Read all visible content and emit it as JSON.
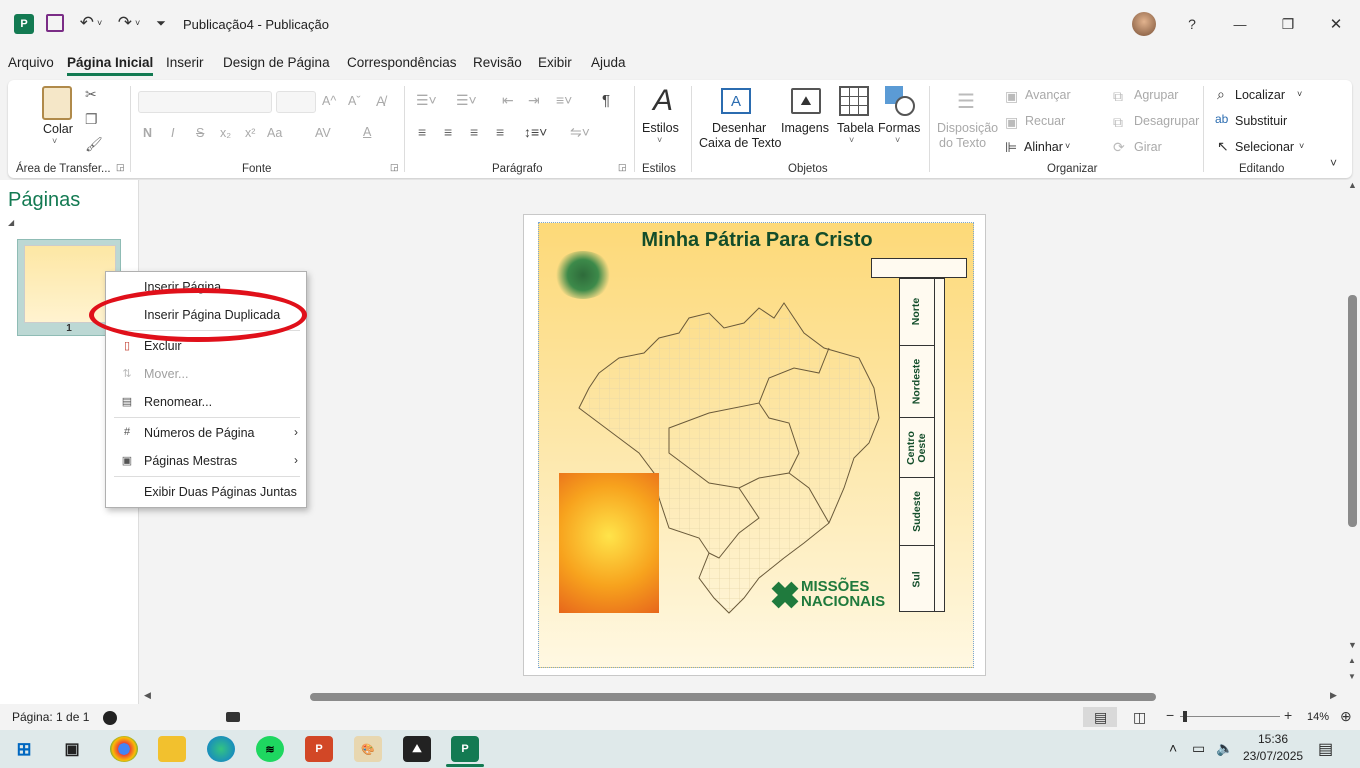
{
  "window": {
    "title": "Publicação4  -  Publicação"
  },
  "titlebar": {
    "help": "?",
    "minimize": "—",
    "restore": "❐",
    "close": "✕"
  },
  "tabs": [
    "Arquivo",
    "Página Inicial",
    "Inserir",
    "Design de Página",
    "Correspondências",
    "Revisão",
    "Exibir",
    "Ajuda"
  ],
  "ribbon": {
    "clipboard": {
      "paste": "Colar",
      "group": "Área de Transfer..."
    },
    "font": {
      "group": "Fonte",
      "bold": "N",
      "italic": "I",
      "strike": "S",
      "sub": "x₂",
      "sup": "x²",
      "case": "Aa",
      "spacing": "AV",
      "color": "A",
      "grow": "A^",
      "shrink": "Aˇ"
    },
    "paragraph": {
      "group": "Parágrafo",
      "pilcrow": "¶"
    },
    "styles": {
      "label": "Estilos",
      "group": "Estilos"
    },
    "objects": {
      "textbox_line1": "Desenhar",
      "textbox_line2": "Caixa de Texto",
      "images": "Imagens",
      "table": "Tabela",
      "shapes": "Formas",
      "group": "Objetos"
    },
    "arrange": {
      "wrap_line1": "Disposição",
      "wrap_line2": "do Texto",
      "forward": "Avançar",
      "backward": "Recuar",
      "align": "Alinhar",
      "group_btn": "Agrupar",
      "ungroup": "Desagrupar",
      "rotate": "Girar",
      "group": "Organizar"
    },
    "editing": {
      "find": "Localizar",
      "replace": "Substituir",
      "select": "Selecionar",
      "group": "Editando"
    }
  },
  "pane": {
    "title": "Páginas",
    "page_number": "1"
  },
  "document": {
    "title": "Minha Pátria Para Cristo",
    "regions": [
      "Norte",
      "Nordeste",
      "Centro Oeste",
      "Sudeste",
      "Sul"
    ],
    "logo_line1": "MISSÕES",
    "logo_line2": "NACIONAIS"
  },
  "context_menu": [
    {
      "label": "Inserir Página",
      "icon": "",
      "disabled": false
    },
    {
      "label": "Inserir Página Duplicada",
      "icon": "",
      "disabled": false
    },
    {
      "label": "Excluir",
      "icon": "delete-page-icon",
      "disabled": false
    },
    {
      "label": "Mover...",
      "icon": "move-page-icon",
      "disabled": true
    },
    {
      "label": "Renomear...",
      "icon": "rename-icon",
      "disabled": false
    },
    {
      "label": "Números de Página",
      "icon": "page-number-icon",
      "disabled": false,
      "submenu": true
    },
    {
      "label": "Páginas Mestras",
      "icon": "master-page-icon",
      "disabled": false,
      "submenu": true
    },
    {
      "label": "Exibir Duas Páginas Juntas",
      "icon": "",
      "disabled": false
    }
  ],
  "status": {
    "page": "Página: 1 de 1",
    "zoom": "14%"
  },
  "clock": {
    "time": "15:36",
    "date": "23/07/2025"
  },
  "colors": {
    "accent": "#137a52",
    "highlight": "#e0101a"
  }
}
